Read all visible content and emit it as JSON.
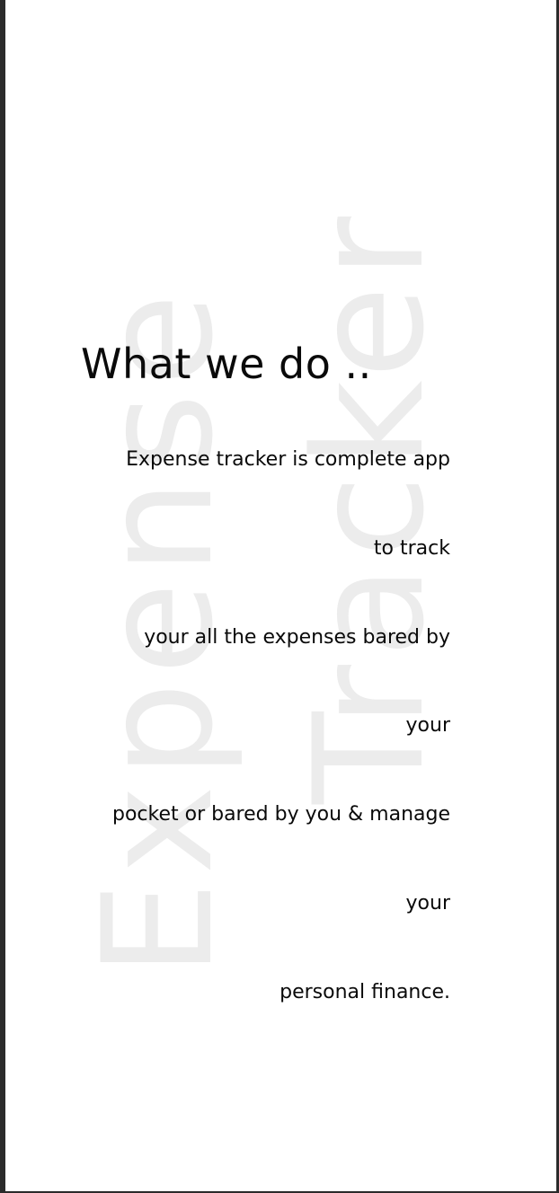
{
  "watermark": {
    "word1": "Expense",
    "word2": "Tracker"
  },
  "section": {
    "heading": "What we do ..",
    "lines": [
      "Expense tracker is complete app",
      "to track",
      "your all the expenses bared by",
      "your",
      "pocket or bared by you & manage",
      "your",
      "personal finance."
    ]
  }
}
